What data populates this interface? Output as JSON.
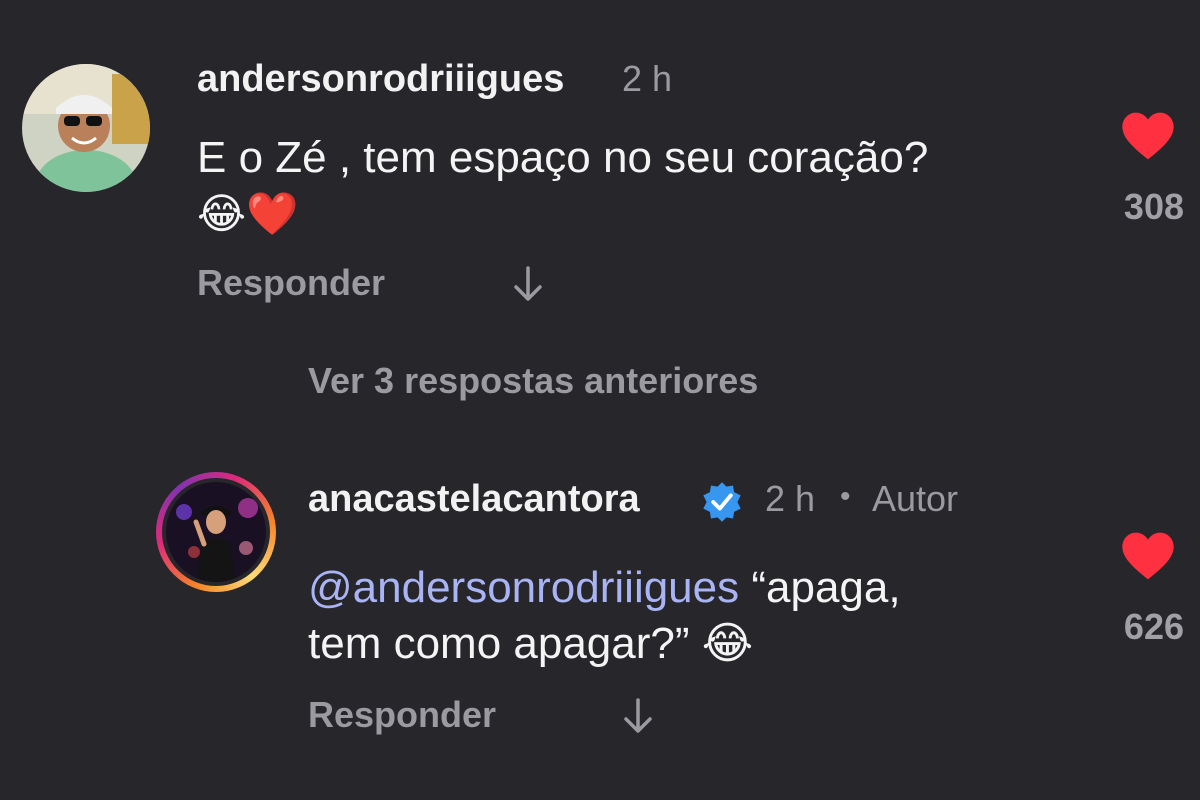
{
  "comment1": {
    "username": "andersonrodriiigues",
    "time": "2 h",
    "text": "E o Zé , tem espaço no seu coração?",
    "emojis": "😂❤️",
    "reply_label": "Responder",
    "like_count": "308",
    "translate_icon": "arrow-down-icon"
  },
  "view_replies": "Ver 3 respostas anteriores",
  "comment2": {
    "username": "anacastelacantora",
    "time": "2 h",
    "separator": "•",
    "author_badge": "Autor",
    "mention": "@andersonrodriiigues",
    "text_line1_rest": " “apaga,",
    "text_line2": "tem como apagar?” 😂",
    "reply_label": "Responder",
    "like_count": "626"
  },
  "colors": {
    "background": "#26262b",
    "heart": "#ff3040",
    "mention": "#a9b4f5",
    "verified": "#3797f0"
  }
}
